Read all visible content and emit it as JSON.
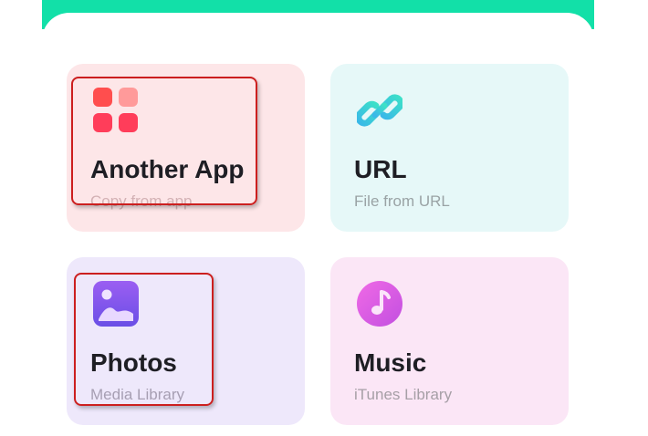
{
  "colors": {
    "header_accent": "#12e0a8",
    "highlight": "#cc1f1f",
    "another_app_card_bg": "#fde6e8",
    "url_card_bg": "#e6f8f8",
    "photos_card_bg": "#eee8fb",
    "music_card_bg": "#fbe6f6",
    "title_text": "#1e1e24"
  },
  "cards": [
    {
      "id": "another-app",
      "title": "Another App",
      "subtitle": "Copy from app",
      "icon": "app-grid-icon",
      "subtitle_color": "#d3b1b4"
    },
    {
      "id": "url",
      "title": "URL",
      "subtitle": "File from URL",
      "icon": "link-icon",
      "subtitle_color": "#9aa3a5"
    },
    {
      "id": "photos",
      "title": "Photos",
      "subtitle": "Media Library",
      "icon": "photo-icon",
      "subtitle_color": "#a79fb3"
    },
    {
      "id": "music",
      "title": "Music",
      "subtitle": "iTunes Library",
      "icon": "music-note-icon",
      "subtitle_color": "#a69fa6"
    }
  ]
}
